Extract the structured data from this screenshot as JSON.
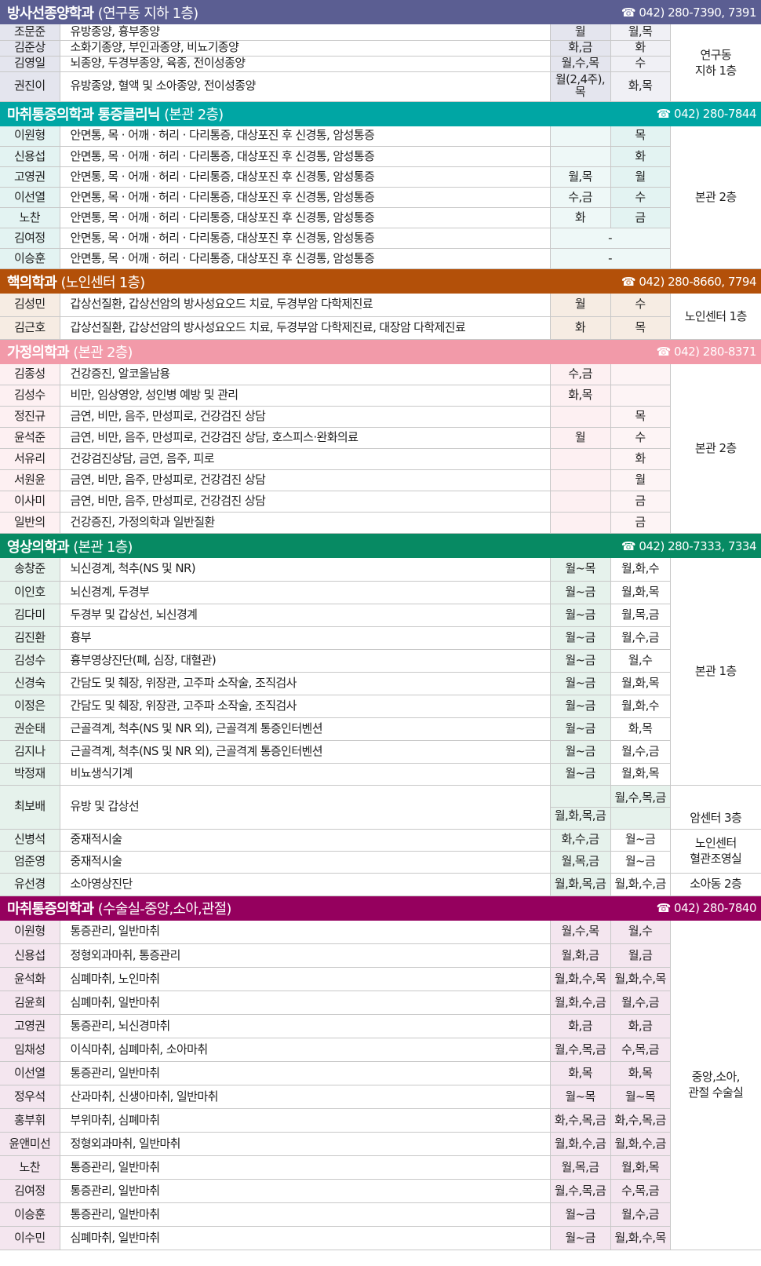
{
  "colors": {
    "radiation": "#5b5e92",
    "pain_clinic": "#00a6a4",
    "nuclear": "#b35009",
    "family": "#f29aa9",
    "imaging": "#078a63",
    "anesthesia": "#95005e"
  },
  "icons": {
    "phone": "☎"
  },
  "sections": [
    {
      "id": "radiation",
      "title": "방사선종양학과",
      "location": "(연구동 지하 1층)",
      "phone": "042) 280-7390, 7391",
      "header_color": "#5b5e92",
      "name_bg": "#e4e5ee",
      "day1_bg": "#e4e5ee",
      "day2_bg": "#f0f0f5",
      "header_height": 31,
      "row_heights": [
        20,
        20,
        20,
        38
      ],
      "rows": [
        {
          "name": "조문준",
          "specialty": "유방종양, 흉부종양",
          "day1": "월",
          "day2": "월,목"
        },
        {
          "name": "김준상",
          "specialty": "소화기종양, 부인과종양, 비뇨기종양",
          "day1": "화,금",
          "day2": "화"
        },
        {
          "name": "김영일",
          "specialty": "뇌종양, 두경부종양, 육종, 전이성종양",
          "day1": "월,수,목",
          "day2": "수"
        },
        {
          "name": "권진이",
          "specialty": "유방종양, 혈액 및 소아종양, 전이성종양",
          "day1": "월(2,4주), 목",
          "day2": "화,목"
        }
      ],
      "locations": [
        {
          "text": "연구동\n지하 1층",
          "span": 4
        }
      ]
    },
    {
      "id": "pain_clinic",
      "title": "마취통증의학과 통증클리닉",
      "location": "(본관 2층)",
      "phone": "042) 280-7844",
      "header_color": "#00a6a4",
      "name_bg": "#e3f3f2",
      "day1_bg": "#eef8f7",
      "day2_bg": "#e3f3f2",
      "header_height": 31,
      "row_heights": [
        26,
        26,
        26,
        26,
        26,
        26,
        26
      ],
      "rows": [
        {
          "name": "이원형",
          "specialty": "안면통, 목 · 어깨 · 허리 · 다리통증, 대상포진 후 신경통, 암성통증",
          "day1": "",
          "day2": "목"
        },
        {
          "name": "신용섭",
          "specialty": "안면통, 목 · 어깨 · 허리 · 다리통증, 대상포진 후 신경통, 암성통증",
          "day1": "",
          "day2": "화"
        },
        {
          "name": "고영권",
          "specialty": "안면통, 목 · 어깨 · 허리 · 다리통증, 대상포진 후 신경통, 암성통증",
          "day1": "월,목",
          "day2": "월"
        },
        {
          "name": "이선열",
          "specialty": "안면통, 목 · 어깨 · 허리 · 다리통증, 대상포진 후 신경통, 암성통증",
          "day1": "수,금",
          "day2": "수"
        },
        {
          "name": "노찬",
          "specialty": "안면통, 목 · 어깨 · 허리 · 다리통증, 대상포진 후 신경통, 암성통증",
          "day1": "화",
          "day2": "금"
        },
        {
          "name": "김여정",
          "specialty": "안면통, 목 · 어깨 · 허리 · 다리통증, 대상포진 후 신경통, 암성통증",
          "dash": "-"
        },
        {
          "name": "이승훈",
          "specialty": "안면통, 목 · 어깨 · 허리 · 다리통증, 대상포진 후 신경통, 암성통증",
          "dash": "-"
        }
      ],
      "locations": [
        {
          "text": "본관 2층",
          "span": 7
        }
      ]
    },
    {
      "id": "nuclear",
      "title": "핵의학과",
      "location": "(노인센터 1층)",
      "phone": "042) 280-8660, 7794",
      "header_color": "#b35009",
      "name_bg": "#f6ece3",
      "day1_bg": "#f6ece3",
      "day2_bg": "#f6ece3",
      "header_height": 31,
      "row_heights": [
        29,
        29
      ],
      "rows": [
        {
          "name": "김성민",
          "specialty": "갑상선질환, 갑상선암의 방사성요오드 치료, 두경부암 다학제진료",
          "day1": "월",
          "day2": "수"
        },
        {
          "name": "김근호",
          "specialty": "갑상선질환, 갑상선암의 방사성요오드 치료, 두경부암 다학제진료, 대장암 다학제진료",
          "day1": "화",
          "day2": "목"
        }
      ],
      "locations": [
        {
          "text": "노인센터 1층",
          "span": 2
        }
      ]
    },
    {
      "id": "family",
      "title": "가정의학과",
      "location": "(본관 2층)",
      "phone": "042) 280-8371",
      "header_color": "#f29aa9",
      "name_bg": "#fdf0f2",
      "day1_bg": "#fdf0f2",
      "day2_bg": "#fdf4f5",
      "header_height": 31,
      "row_heights": [
        27,
        27,
        27,
        27,
        27,
        27,
        27,
        27
      ],
      "rows": [
        {
          "name": "김종성",
          "specialty": "건강증진, 알코올남용",
          "day1": "수,금",
          "day2": ""
        },
        {
          "name": "김성수",
          "specialty": "비만, 임상영양, 성인병 예방 및 관리",
          "day1": "화,목",
          "day2": ""
        },
        {
          "name": "정진규",
          "specialty": "금연, 비만, 음주, 만성피로, 건강검진 상담",
          "day1": "",
          "day2": "목"
        },
        {
          "name": "윤석준",
          "specialty": "금연, 비만, 음주, 만성피로, 건강검진 상담, 호스피스·완화의료",
          "day1": "월",
          "day2": "수"
        },
        {
          "name": "서유리",
          "specialty": "건강검진상담, 금연, 음주, 피로",
          "day1": "",
          "day2": "화"
        },
        {
          "name": "서원윤",
          "specialty": "금연, 비만, 음주, 만성피로, 건강검진 상담",
          "day1": "",
          "day2": "월"
        },
        {
          "name": "이사미",
          "specialty": "금연, 비만, 음주, 만성피로, 건강검진 상담",
          "day1": "",
          "day2": "금"
        },
        {
          "name": "일반의",
          "specialty": "건강증진, 가정의학과 일반질환",
          "day1": "",
          "day2": "금"
        }
      ],
      "locations": [
        {
          "text": "본관 2층",
          "span": 8
        }
      ]
    },
    {
      "id": "imaging",
      "title": "영상의학과",
      "location": "(본관 1층)",
      "phone": "042) 280-7333, 7334",
      "header_color": "#078a63",
      "name_bg": "#e6f2ec",
      "day1_bg": "#e6f2ec",
      "day2_bg": "#ffffff",
      "header_height": 31,
      "row_heights": [
        29,
        29,
        29,
        29,
        29,
        29,
        29,
        29,
        29,
        28,
        56,
        28,
        28,
        29
      ],
      "rows": [
        {
          "name": "송창준",
          "specialty": "뇌신경계, 척추(NS 및 NR)",
          "day1": "월~목",
          "day2": "월,화,수"
        },
        {
          "name": "이인호",
          "specialty": "뇌신경계, 두경부",
          "day1": "월~금",
          "day2": "월,화,목"
        },
        {
          "name": "김다미",
          "specialty": "두경부 및 갑상선, 뇌신경계",
          "day1": "월~금",
          "day2": "월,목,금"
        },
        {
          "name": "김진환",
          "specialty": "흉부",
          "day1": "월~금",
          "day2": "월,수,금"
        },
        {
          "name": "김성수",
          "specialty": "흉부영상진단(폐, 심장, 대혈관)",
          "day1": "월~금",
          "day2": "월,수"
        },
        {
          "name": "신경숙",
          "specialty": "간담도 및 췌장, 위장관, 고주파 소작술, 조직검사",
          "day1": "월~금",
          "day2": "월,화,목"
        },
        {
          "name": "이정은",
          "specialty": "간담도 및 췌장, 위장관, 고주파 소작술, 조직검사",
          "day1": "월~금",
          "day2": "월,화,수"
        },
        {
          "name": "권순태",
          "specialty": "근골격계, 척추(NS 및 NR 외), 근골격계 통증인터벤션",
          "day1": "월~금",
          "day2": "화,목"
        },
        {
          "name": "김지나",
          "specialty": "근골격계, 척추(NS 및 NR 외), 근골격계 통증인터벤션",
          "day1": "월~금",
          "day2": "월,수,금"
        },
        {
          "name": "박정재",
          "specialty": "비뇨생식기계",
          "day1": "월~금",
          "day2": "월,화,목"
        },
        {
          "name": "최보배",
          "specialty": "유방 및 갑상선",
          "day1": "월,화,목,금",
          "day2": "월,수,목,금",
          "split": true
        },
        {
          "name": "신병석",
          "specialty": "중재적시술",
          "day1": "화,수,금",
          "day2": "월~금"
        },
        {
          "name": "엄준영",
          "specialty": "중재적시술",
          "day1": "월,목,금",
          "day2": "월~금"
        },
        {
          "name": "유선경",
          "specialty": "소아영상진단",
          "day1": "월,화,목,금",
          "day2": "월,화,수,금"
        }
      ],
      "locations": [
        {
          "text": "본관 1층",
          "span": 10
        },
        {
          "text": "",
          "span": 1,
          "split_top": true
        },
        {
          "text": "암센터 3층",
          "span": 1,
          "split_bottom": true
        },
        {
          "text": "노인센터\n혈관조영실",
          "span": 2
        },
        {
          "text": "소아동 2층",
          "span": 1
        }
      ]
    },
    {
      "id": "anesthesia",
      "title": "마취통증의학과",
      "location": "(수술실-중앙,소아,관절)",
      "phone": "042) 280-7840",
      "header_color": "#95005e",
      "name_bg": "#f4e6ef",
      "day1_bg": "#f4e6ef",
      "day2_bg": "#f4e6ef",
      "header_height": 31,
      "row_heights": [
        30,
        30,
        30,
        30,
        30,
        30,
        30,
        30,
        30,
        30,
        30,
        30,
        30,
        30
      ],
      "rows": [
        {
          "name": "이원형",
          "specialty": "통증관리, 일반마취",
          "day1": "월,수,목",
          "day2": "월,수"
        },
        {
          "name": "신용섭",
          "specialty": "정형외과마취, 통증관리",
          "day1": "월,화,금",
          "day2": "월,금"
        },
        {
          "name": "윤석화",
          "specialty": "심폐마취, 노인마취",
          "day1": "월,화,수,목",
          "day2": "월,화,수,목"
        },
        {
          "name": "김윤희",
          "specialty": "심폐마취, 일반마취",
          "day1": "월,화,수,금",
          "day2": "월,수,금"
        },
        {
          "name": "고영권",
          "specialty": "통증관리, 뇌신경마취",
          "day1": "화,금",
          "day2": "화,금"
        },
        {
          "name": "임채성",
          "specialty": "이식마취, 심폐마취, 소아마취",
          "day1": "월,수,목,금",
          "day2": "수,목,금"
        },
        {
          "name": "이선열",
          "specialty": "통증관리, 일반마취",
          "day1": "화,목",
          "day2": "화,목"
        },
        {
          "name": "정우석",
          "specialty": "산과마취, 신생아마취, 일반마취",
          "day1": "월~목",
          "day2": "월~목"
        },
        {
          "name": "홍부휘",
          "specialty": "부위마취, 심폐마취",
          "day1": "화,수,목,금",
          "day2": "화,수,목,금"
        },
        {
          "name": "윤앤미선",
          "specialty": "정형외과마취, 일반마취",
          "day1": "월,화,수,금",
          "day2": "월,화,수,금"
        },
        {
          "name": "노찬",
          "specialty": "통증관리, 일반마취",
          "day1": "월,목,금",
          "day2": "월,화,목"
        },
        {
          "name": "김여정",
          "specialty": "통증관리, 일반마취",
          "day1": "월,수,목,금",
          "day2": "수,목,금"
        },
        {
          "name": "이승훈",
          "specialty": "통증관리, 일반마취",
          "day1": "월~금",
          "day2": "월,수,금"
        },
        {
          "name": "이수민",
          "specialty": "심폐마취, 일반마취",
          "day1": "월~금",
          "day2": "월,화,수,목"
        }
      ],
      "locations": [
        {
          "text": "중앙,소아,\n관절 수술실",
          "span": 14
        }
      ]
    }
  ]
}
